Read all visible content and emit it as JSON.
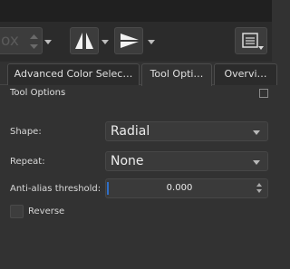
{
  "toolbar": {
    "partial_text": "ox"
  },
  "tabs": [
    {
      "label": "Advanced Color Selec…"
    },
    {
      "label": "Tool Opti…"
    },
    {
      "label": "Overvi…"
    }
  ],
  "panel": {
    "title": "Tool Options"
  },
  "options": {
    "shape_label": "Shape:",
    "shape_value": "Radial",
    "repeat_label": "Repeat:",
    "repeat_value": "None",
    "threshold_label": "Anti-alias threshold:",
    "threshold_value": "0.000",
    "reverse_label": "Reverse",
    "reverse_checked": false
  },
  "colors": {
    "accent": "#2f6fc8"
  }
}
